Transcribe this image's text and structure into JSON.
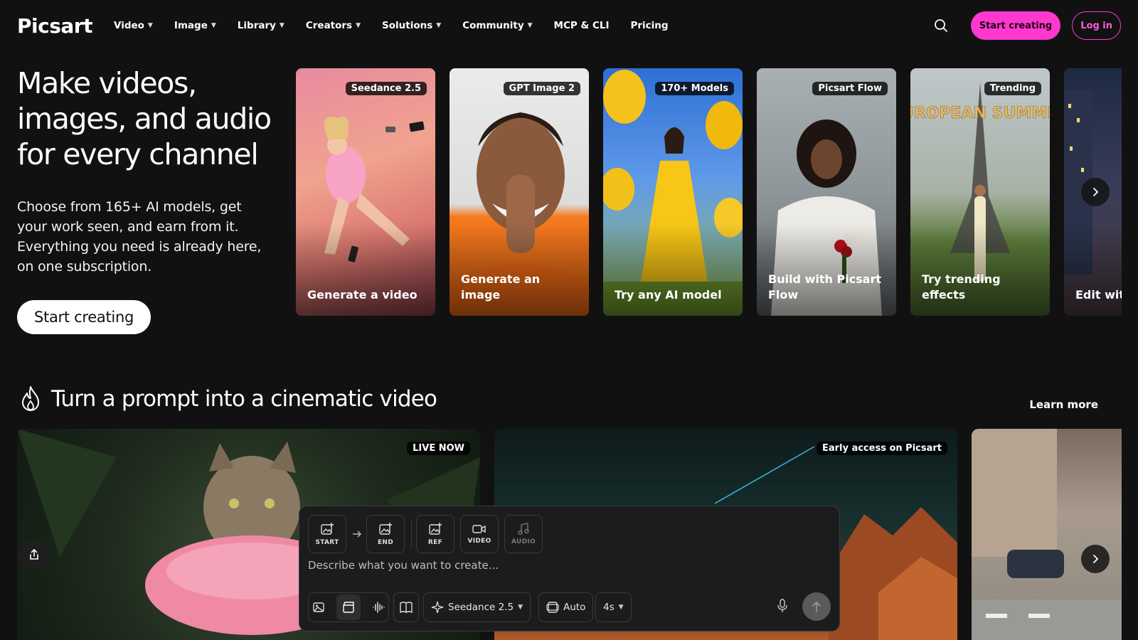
{
  "brand": {
    "logo_text": "Picsart",
    "accent": "#ff38ce"
  },
  "nav": {
    "links": [
      "Video",
      "Image",
      "Library",
      "Creators",
      "Solutions",
      "Community",
      "MCP & CLI",
      "Pricing"
    ],
    "start_creating": "Start creating",
    "login": "Log in"
  },
  "hero": {
    "title": "Make videos, images, and audio for every channel",
    "subtitle": "Choose from 165+ AI models, get your work seen, and earn from it. Everything you need is already here, on one subscription.",
    "cta": "Start creating"
  },
  "cards": [
    {
      "badge": "Seedance 2.5",
      "label": "Generate a video"
    },
    {
      "badge": "GPT Image 2",
      "label": "Generate an image"
    },
    {
      "badge": "170+ Models",
      "label": "Try any AI model"
    },
    {
      "badge": "Picsart Flow",
      "label": "Build with Picsart Flow"
    },
    {
      "badge": "Trending",
      "label": "Try trending effects",
      "art_text": "EUROPEAN SUMMER"
    },
    {
      "badge": "",
      "label": "Edit with prompt"
    }
  ],
  "section": {
    "title": "Turn a prompt into a cinematic video",
    "learn_more": "Learn more",
    "videos": [
      {
        "badge": "LIVE NOW"
      },
      {
        "badge": "Early access on Picsart"
      },
      {
        "badge": ""
      }
    ]
  },
  "prompt_panel": {
    "tools": [
      "START",
      "END",
      "REF",
      "VIDEO",
      "AUDIO"
    ],
    "placeholder": "Describe what you want to create...",
    "model": "Seedance 2.5",
    "aspect": "Auto",
    "duration": "4s"
  }
}
